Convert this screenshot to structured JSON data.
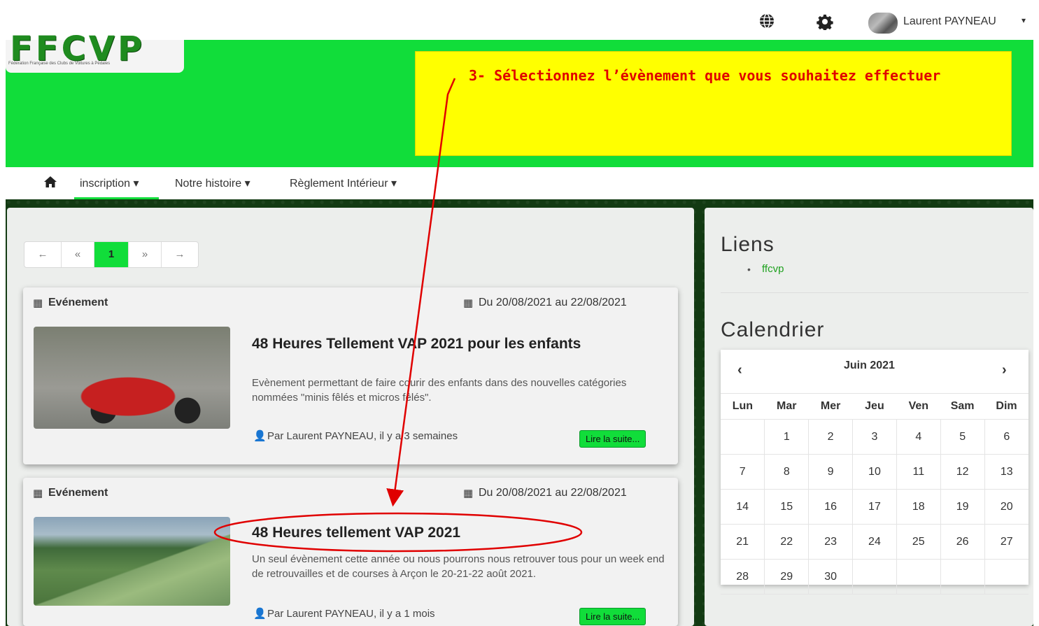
{
  "topbar": {
    "globe_icon": "globe-icon",
    "gear_icon": "gear-icon",
    "user_name": "Laurent PAYNEAU",
    "caret": "▾"
  },
  "logo": {
    "text": "FFCVP",
    "subtitle": "Fédération Française des Clubs de Voitures à Pédales"
  },
  "annotation": {
    "text": "3- Sélectionnez l’évènement que vous souhaitez effectuer",
    "color": "#e00000",
    "box_color": "#ffff00"
  },
  "colors": {
    "accent": "#11dd3a",
    "background": "#123a12"
  },
  "nav": {
    "home_icon": "home-icon",
    "items": [
      {
        "label": "inscription ▾"
      },
      {
        "label": "Notre histoire ▾"
      },
      {
        "label": "Règlement Intérieur ▾"
      }
    ]
  },
  "pagination": {
    "first": "←",
    "prev": "«",
    "current": "1",
    "next": "»",
    "last": "→"
  },
  "cards": [
    {
      "type": "Evénement",
      "date": "Du 20/08/2021 au 22/08/2021",
      "title": "48 Heures Tellement VAP 2021 pour les enfants",
      "description": "Evènement permettant de faire courir des enfants dans des nouvelles catégories nommées \"minis fêlés et micros fêlés\".",
      "meta": "Par Laurent PAYNEAU, il y a 3 semaines",
      "button": "Lire la suite..."
    },
    {
      "type": "Evénement",
      "date": "Du 20/08/2021 au 22/08/2021",
      "title": "48 Heures tellement VAP 2021",
      "description": "Un seul évènement cette année ou nous pourrons nous retrouver tous pour un week end de retrouvailles et de courses à Arçon le 20-21-22 août 2021.",
      "meta": "Par Laurent PAYNEAU, il y a 1 mois",
      "button": "Lire la suite..."
    }
  ],
  "sidebar": {
    "links_title": "Liens",
    "links": [
      "ffcvp"
    ],
    "calendar_title": "Calendrier",
    "calendar": {
      "prev": "‹",
      "next": "›",
      "month": "Juin 2021",
      "weekdays": [
        "Lun",
        "Mar",
        "Mer",
        "Jeu",
        "Ven",
        "Sam",
        "Dim"
      ],
      "weeks": [
        [
          "",
          "1",
          "2",
          "3",
          "4",
          "5",
          "6"
        ],
        [
          "7",
          "8",
          "9",
          "10",
          "11",
          "12",
          "13"
        ],
        [
          "14",
          "15",
          "16",
          "17",
          "18",
          "19",
          "20"
        ],
        [
          "21",
          "22",
          "23",
          "24",
          "25",
          "26",
          "27"
        ],
        [
          "28",
          "29",
          "30",
          "",
          "",
          "",
          ""
        ]
      ]
    }
  }
}
